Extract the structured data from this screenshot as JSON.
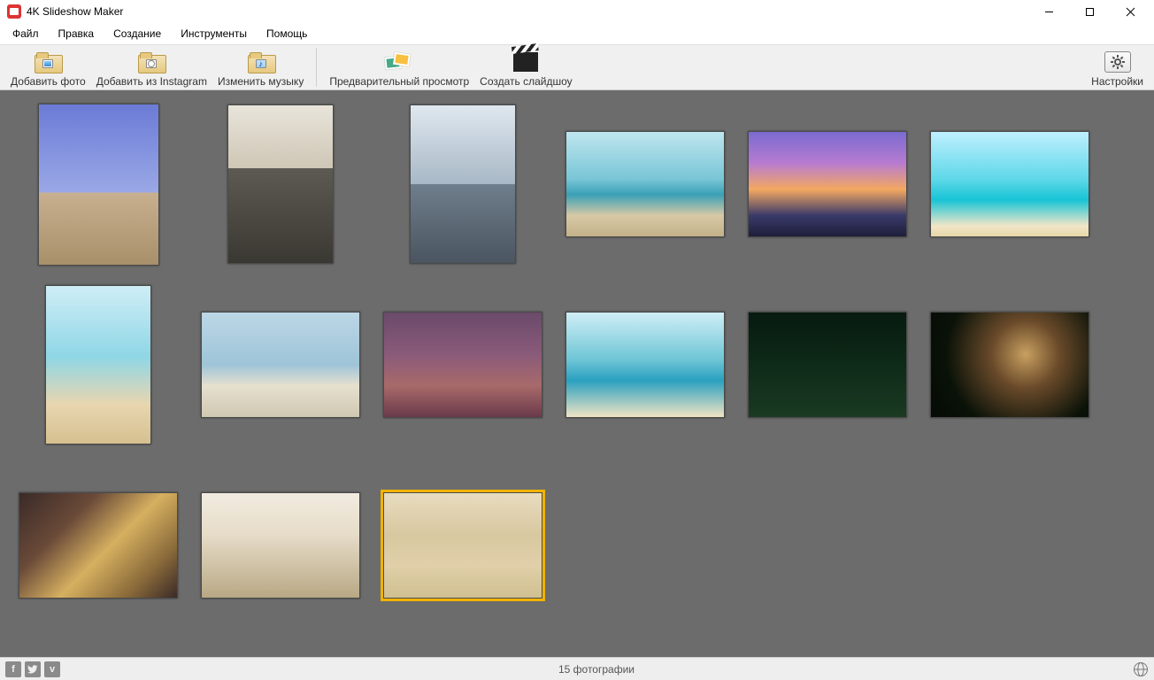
{
  "titlebar": {
    "title": "4K Slideshow Maker"
  },
  "menu": {
    "file": "Файл",
    "edit": "Правка",
    "create": "Создание",
    "tools": "Инструменты",
    "help": "Помощь"
  },
  "toolbar": {
    "add_photo": "Добавить фото",
    "add_instagram": "Добавить из Instagram",
    "change_music": "Изменить музыку",
    "preview": "Предварительный просмотр",
    "create_slideshow": "Создать слайдшоу",
    "settings": "Настройки"
  },
  "thumbs": [
    {
      "id": 1,
      "orient": "portrait-tall",
      "selected": false,
      "palette": "eiffel"
    },
    {
      "id": 2,
      "orient": "portrait-narrow",
      "selected": false,
      "palette": "balcony"
    },
    {
      "id": 3,
      "orient": "portrait-narrow",
      "selected": false,
      "palette": "skyline"
    },
    {
      "id": 4,
      "orient": "landscape",
      "selected": false,
      "palette": "beach1"
    },
    {
      "id": 5,
      "orient": "landscape",
      "selected": false,
      "palette": "sunset"
    },
    {
      "id": 6,
      "orient": "landscape",
      "selected": false,
      "palette": "turquoise"
    },
    {
      "id": 7,
      "orient": "portrait-narrow",
      "selected": false,
      "palette": "bikini"
    },
    {
      "id": 8,
      "orient": "landscape",
      "selected": false,
      "palette": "lifeguard"
    },
    {
      "id": 9,
      "orient": "landscape",
      "selected": false,
      "palette": "family"
    },
    {
      "id": 10,
      "orient": "landscape",
      "selected": false,
      "palette": "hat"
    },
    {
      "id": 11,
      "orient": "landscape",
      "selected": false,
      "palette": "xmas1"
    },
    {
      "id": 12,
      "orient": "landscape",
      "selected": false,
      "palette": "xmas2"
    },
    {
      "id": 13,
      "orient": "landscape",
      "selected": false,
      "palette": "rings"
    },
    {
      "id": 14,
      "orient": "landscape",
      "selected": false,
      "palette": "wedding"
    },
    {
      "id": 15,
      "orient": "landscape",
      "selected": true,
      "palette": "baby"
    }
  ],
  "status": {
    "count_text": "15 фотографии"
  },
  "social": {
    "fb": "f",
    "tw": "t",
    "vimeo": "v"
  }
}
